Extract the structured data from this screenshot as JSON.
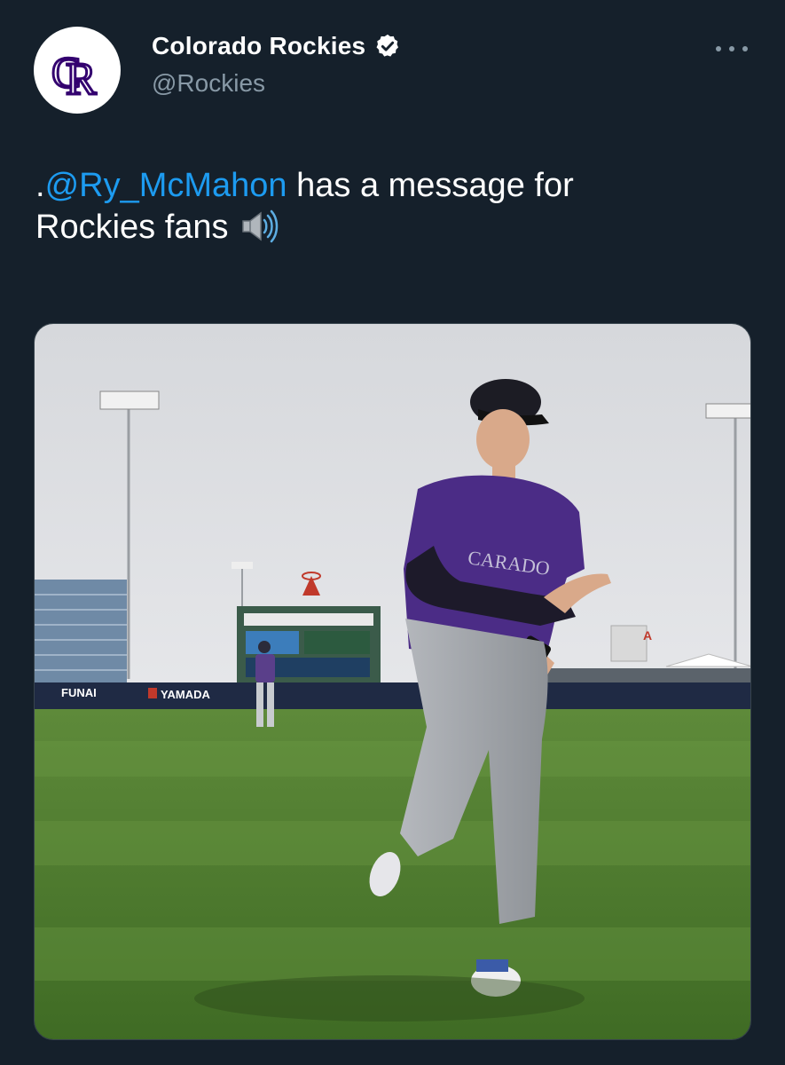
{
  "account": {
    "display_name": "Colorado Rockies",
    "handle": "@Rockies",
    "verified": true,
    "avatar_logo_text": "CR",
    "avatar_icon": "rockies-cr-logo"
  },
  "tweet": {
    "prefix": ".",
    "mention": "@Ry_McMahon",
    "body_line1": " has a message for",
    "body_line2": "Rockies fans",
    "emoji": "speaker-high-volume-icon"
  },
  "media": {
    "type": "video",
    "description_icons": [
      "stadium",
      "player",
      "outfield"
    ],
    "signage": [
      "FUNAI",
      "YAMADA",
      "A"
    ]
  },
  "colors": {
    "background": "#15202b",
    "text": "#ffffff",
    "secondary": "#8899a6",
    "link": "#1d9bf0",
    "verified": "#ffffff"
  }
}
